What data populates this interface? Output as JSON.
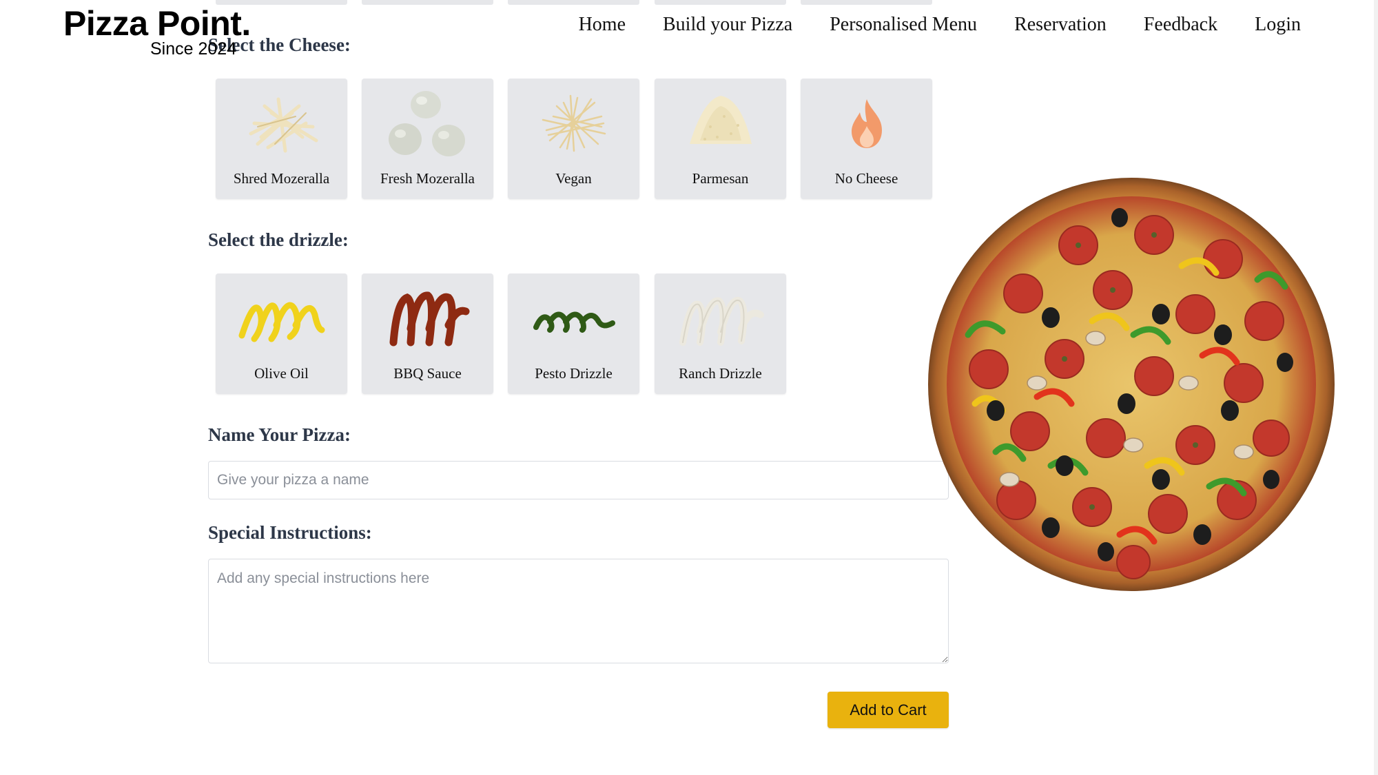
{
  "brand": {
    "title": "Pizza Point.",
    "subtitle": "Since 2024"
  },
  "nav": [
    "Home",
    "Build your Pizza",
    "Personalised Menu",
    "Reservation",
    "Feedback",
    "Login"
  ],
  "cheese": {
    "heading": "Select the Cheese:",
    "options": [
      "Shred Mozeralla",
      "Fresh Mozeralla",
      "Vegan",
      "Parmesan",
      "No Cheese"
    ]
  },
  "drizzle": {
    "heading": "Select the drizzle:",
    "options": [
      "Olive Oil",
      "BBQ Sauce",
      "Pesto Drizzle",
      "Ranch Drizzle"
    ]
  },
  "name_field": {
    "heading": "Name Your Pizza:",
    "placeholder": "Give your pizza a name",
    "value": ""
  },
  "instructions_field": {
    "heading": "Special Instructions:",
    "placeholder": "Add any special instructions here",
    "value": ""
  },
  "cart_button": "Add to Cart",
  "colors": {
    "tile_bg": "#e6e7ea",
    "button": "#e9b20e",
    "heading": "#2d3748"
  },
  "icons": [
    "shred-cheese-icon",
    "fresh-mozzarella-icon",
    "vegan-cheese-icon",
    "parmesan-icon",
    "flame-icon",
    "olive-oil-drizzle-icon",
    "bbq-drizzle-icon",
    "pesto-drizzle-icon",
    "ranch-drizzle-icon",
    "pizza-preview-image"
  ]
}
